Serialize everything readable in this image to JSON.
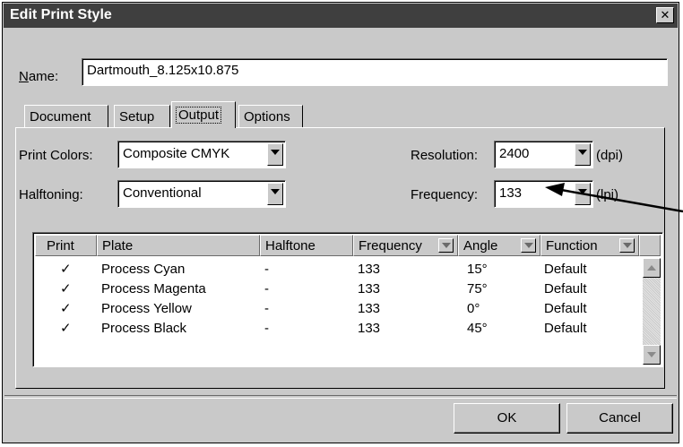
{
  "dialog": {
    "title": "Edit Print Style",
    "close_glyph": "✕"
  },
  "name_field": {
    "label": "Name:",
    "value": "Dartmouth_8.125x10.875"
  },
  "tabs": [
    {
      "label": "Document",
      "active": false
    },
    {
      "label": "Setup",
      "active": false
    },
    {
      "label": "Output",
      "active": true
    },
    {
      "label": "Options",
      "active": false
    }
  ],
  "output": {
    "print_colors": {
      "label": "Print Colors:",
      "value": "Composite CMYK"
    },
    "halftoning": {
      "label": "Halftoning:",
      "value": "Conventional"
    },
    "resolution": {
      "label": "Resolution:",
      "value": "2400",
      "unit": "(dpi)"
    },
    "frequency": {
      "label": "Frequency:",
      "value": "133",
      "unit": "(lpi)"
    }
  },
  "plates_table": {
    "columns": [
      "Print",
      "Plate",
      "Halftone",
      "Frequency",
      "Angle",
      "Function"
    ],
    "rows": [
      {
        "print": "✓",
        "plate": "Process Cyan",
        "halftone": "-",
        "frequency": "133",
        "angle": "15°",
        "function": "Default"
      },
      {
        "print": "✓",
        "plate": "Process Magenta",
        "halftone": "-",
        "frequency": "133",
        "angle": "75°",
        "function": "Default"
      },
      {
        "print": "✓",
        "plate": "Process Yellow",
        "halftone": "-",
        "frequency": "133",
        "angle": "0°",
        "function": "Default"
      },
      {
        "print": "✓",
        "plate": "Process Black",
        "halftone": "-",
        "frequency": "133",
        "angle": "45°",
        "function": "Default"
      }
    ]
  },
  "buttons": {
    "ok": "OK",
    "cancel": "Cancel"
  },
  "colors": {
    "title_bar": "#3f3f3f",
    "dialog_face": "#c9c9c9",
    "field_bg": "#ffffff"
  }
}
